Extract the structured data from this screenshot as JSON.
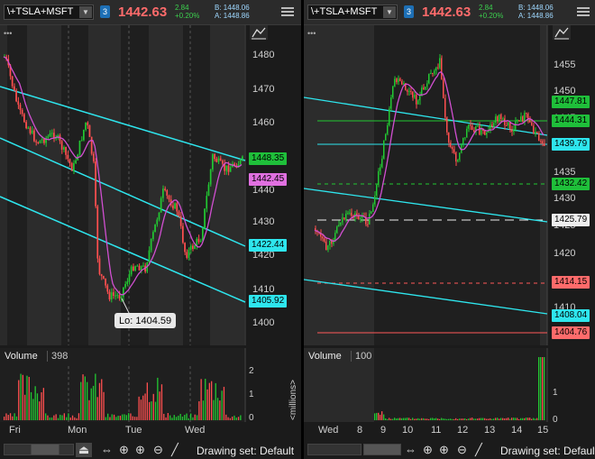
{
  "left": {
    "symbol": "\\+TSLA+MSFT",
    "badge": "3",
    "last": "1442.63",
    "change": "2.84",
    "change_pct": "+0.20%",
    "bid": "B: 1448.06",
    "ask": "A: 1448.86",
    "price_ticks": [
      "1480",
      "1470",
      "1460",
      "1450",
      "1440",
      "1430",
      "1420",
      "1410",
      "1400"
    ],
    "tags": {
      "t1": "1448.35",
      "t2": "1442.45",
      "t3": "1422.44",
      "t4": "1405.92"
    },
    "low_bubble": "Lo: 1404.59",
    "days": [
      "Fri",
      "Mon",
      "Tue",
      "Wed"
    ],
    "volume_label": "Volume",
    "volume_value": "398",
    "vol_ticks": [
      "2",
      "1",
      "0"
    ],
    "vol_unit": "<millions>",
    "drawing_set": "Drawing set: Default"
  },
  "right": {
    "symbol": "\\+TSLA+MSFT",
    "badge": "3",
    "last": "1442.63",
    "change": "2.84",
    "change_pct": "+0.20%",
    "bid": "B: 1448.06",
    "ask": "A: 1448.86",
    "price_ticks": [
      "1455",
      "1450",
      "1445",
      "1440",
      "1435",
      "1430",
      "1425",
      "1420",
      "1415",
      "1410",
      "1405"
    ],
    "tags": {
      "t1": "1447.81",
      "t2": "1444.31",
      "t3": "1439.79",
      "t4": "1432.42",
      "t5": "1425.79",
      "t6": "1414.15",
      "t7": "1408.04",
      "t8": "1404.76"
    },
    "hours": [
      "Wed",
      "8",
      "9",
      "10",
      "11",
      "12",
      "13",
      "14",
      "15"
    ],
    "volume_label": "Volume",
    "volume_value": "100",
    "vol_ticks": [
      "1",
      "0"
    ],
    "drawing_set": "Drawing set: Default"
  },
  "colors": {
    "up": "#22c832",
    "down": "#ff4f4f",
    "trend": "#2ee6ee",
    "ma": "#d14fd1",
    "accent": "#1d6fb5"
  }
}
